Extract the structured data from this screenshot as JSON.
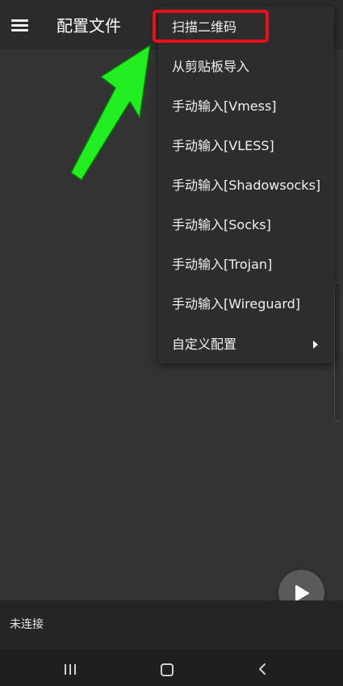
{
  "appbar": {
    "menu_icon": "hamburger-menu-icon",
    "title": "配置文件"
  },
  "menu": {
    "items": [
      {
        "label": "扫描二维码"
      },
      {
        "label": "从剪贴板导入"
      },
      {
        "label": "手动输入[Vmess]"
      },
      {
        "label": "手动输入[VLESS]"
      },
      {
        "label": "手动输入[Shadowsocks]"
      },
      {
        "label": "手动输入[Socks]"
      },
      {
        "label": "手动输入[Trojan]"
      },
      {
        "label": "手动输入[Wireguard]"
      },
      {
        "label": "自定义配置",
        "submenu_icon": "submenu-arrow-icon"
      }
    ]
  },
  "annotation": {
    "highlight_color": "#e8101a",
    "arrow_color": "#22ee22"
  },
  "fab": {
    "icon": "play-icon"
  },
  "status": {
    "text": "未连接"
  },
  "navbar": {
    "icons": [
      "recent-apps-icon",
      "home-icon",
      "back-icon"
    ]
  },
  "colors": {
    "background": "#333333",
    "appbar": "#2b2b2b",
    "menu": "#2d2d2d",
    "bottombar": "#252525"
  }
}
